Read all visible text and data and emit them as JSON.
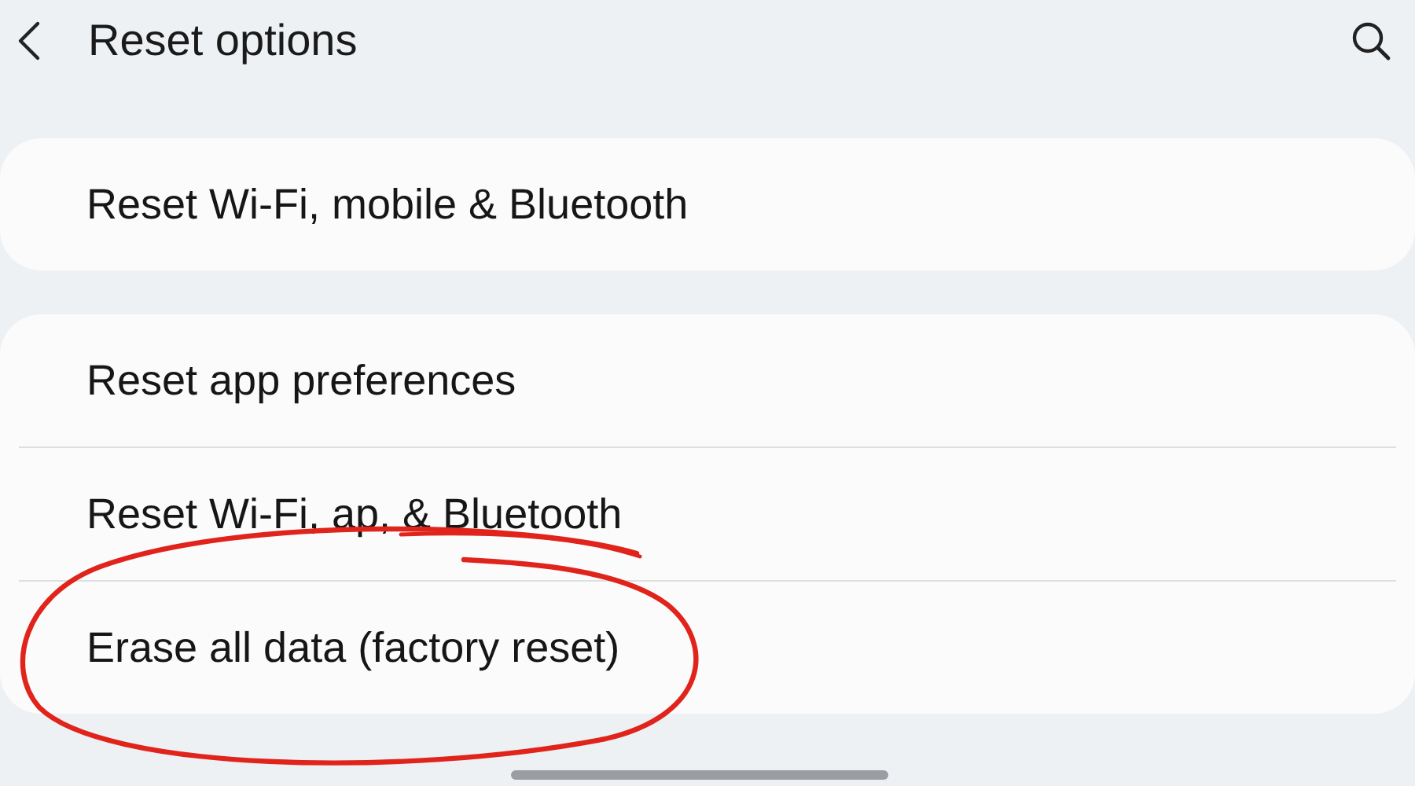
{
  "header": {
    "title": "Reset options"
  },
  "sections": [
    {
      "items": [
        {
          "label": "Reset Wi-Fi, mobile & Bluetooth",
          "circled": false
        }
      ]
    },
    {
      "items": [
        {
          "label": "Reset app preferences",
          "circled": false
        },
        {
          "label": "Reset Wi-Fi, ap, & Bluetooth",
          "circled": false
        },
        {
          "label": "Erase all data (factory reset)",
          "circled": true
        }
      ]
    }
  ]
}
